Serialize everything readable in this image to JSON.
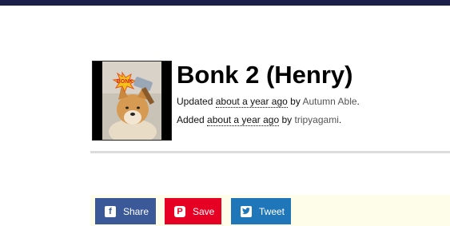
{
  "meme": {
    "title": "Bonk 2 (Henry)",
    "thumbnail_text": "BONK",
    "updated": {
      "prefix": "Updated",
      "time": "about a year ago",
      "by": "by",
      "user": "Autumn Able",
      "suffix": "."
    },
    "added": {
      "prefix": "Added",
      "time": "about a year ago",
      "by": "by",
      "user": "tripyagami",
      "suffix": "."
    }
  },
  "share": {
    "facebook_label": "Share",
    "pinterest_label": "Save",
    "twitter_label": "Tweet",
    "facebook_icon": "facebook-icon",
    "pinterest_icon": "pinterest-icon",
    "twitter_icon": "twitter-icon"
  },
  "colors": {
    "topbar": "#1b1f4a",
    "facebook": "#3b5998",
    "pinterest": "#e60023",
    "twitter": "#1f76b8",
    "share_strip": "#fdfde9"
  }
}
